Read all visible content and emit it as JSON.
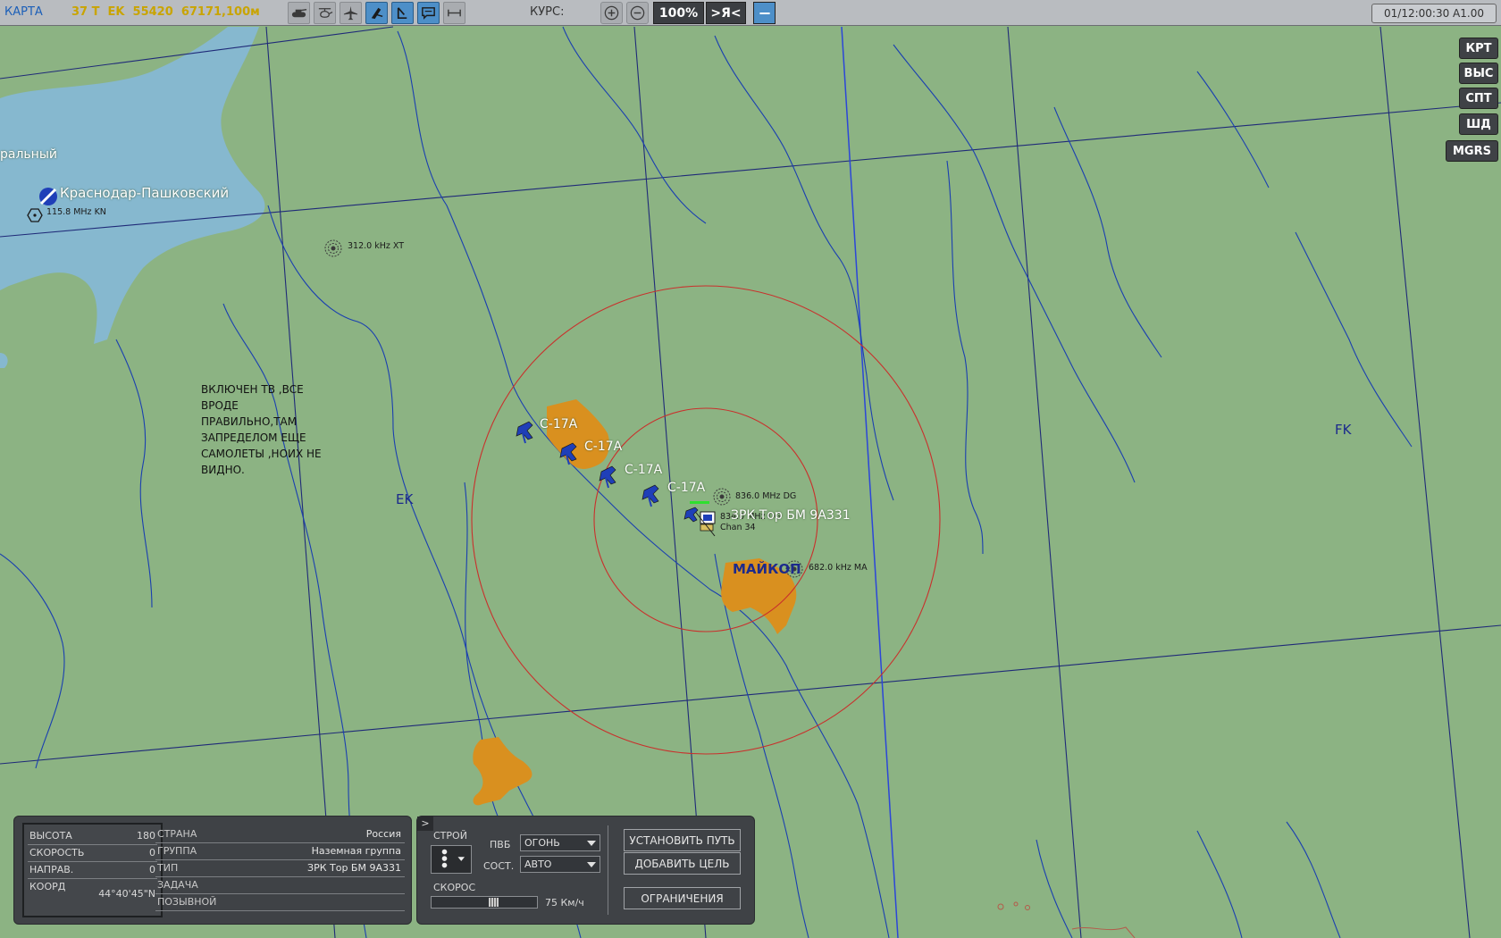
{
  "toolbar": {
    "mode_label": "КАРТА",
    "coords": "37 T  EK  55420  67171,100м",
    "course_label": "КУРС:",
    "zoom": "100%",
    "center_label": ">Я<",
    "clock": "01/12:00:30 A1.00"
  },
  "side_buttons": [
    "КРТ",
    "ВЫС",
    "СПТ",
    "ШД",
    "MGRS"
  ],
  "map": {
    "partial_label": "ральный",
    "airfield_name": "Краснодар-Пашковский",
    "airfield_freq": "115.8 MHz KN",
    "ndb_xt": "312.0 kHz XT",
    "ndb_dg": "836.0 MHz DG",
    "vor_dg": "834.0 MHz DG",
    "tacan": "Chan 34",
    "ndb_ma": "682.0 kHz MA",
    "city": "МАЙКОП",
    "unit_label": "ЗРК Тор БМ 9А331",
    "grid_ek": "EK",
    "grid_fk": "FK",
    "aircraft": [
      "С-17А",
      "С-17А",
      "С-17А",
      "С-17А"
    ],
    "note_lines": [
      "ВКЛЮЧЕН ТВ ,ВСЕ",
      "ВРОДЕ",
      "ПРАВИЛЬНО,ТАМ",
      "ЗАПРЕДЕЛОМ ЕЩЕ",
      "САМОЛЕТЫ ,НОИХ НЕ",
      "ВИДНО."
    ]
  },
  "info_panel": {
    "altitude_label": "ВЫСОТА",
    "altitude_value": "180",
    "speed_label": "СКОРОСТЬ",
    "speed_value": "0",
    "heading_label": "НАПРАВ.",
    "heading_value": "0",
    "coord_label": "КООРД",
    "coord_value": "44°40'45\"N",
    "country_label": "СТРАНА",
    "country_value": "Россия",
    "group_label": "ГРУППА",
    "group_value": "Наземная группа",
    "type_label": "ТИП",
    "type_value": "ЗРК Тор БМ 9А331",
    "task_label": "ЗАДАЧА",
    "task_value": "",
    "callsign_label": "ПОЗЫВНОЙ",
    "callsign_value": ""
  },
  "control_panel": {
    "toggle_label": ">",
    "formation_label": "СТРОЙ",
    "roe_label": "ПВБ",
    "roe_value": "ОГОНЬ",
    "alarm_label": "СОСТ.",
    "alarm_value": "АВТО",
    "speed_label": "СКОРОС",
    "speed_value": "75 Км/ч",
    "speed_fraction": 0.6,
    "set_path_button": "УСТАНОВИТЬ ПУТЬ",
    "add_target_button": "ДОБАВИТЬ ЦЕЛЬ",
    "restrictions_button": "ОГРАНИЧЕНИЯ"
  },
  "colors": {
    "map_bg": "#8cb383",
    "water": "#86b8cf",
    "city": "#d9901f",
    "river": "#1a3fb0",
    "range_ring": "#c9302c",
    "toolbar_text_yellow": "#c9a400",
    "toolbar_text_blue": "#1c5fb8"
  }
}
